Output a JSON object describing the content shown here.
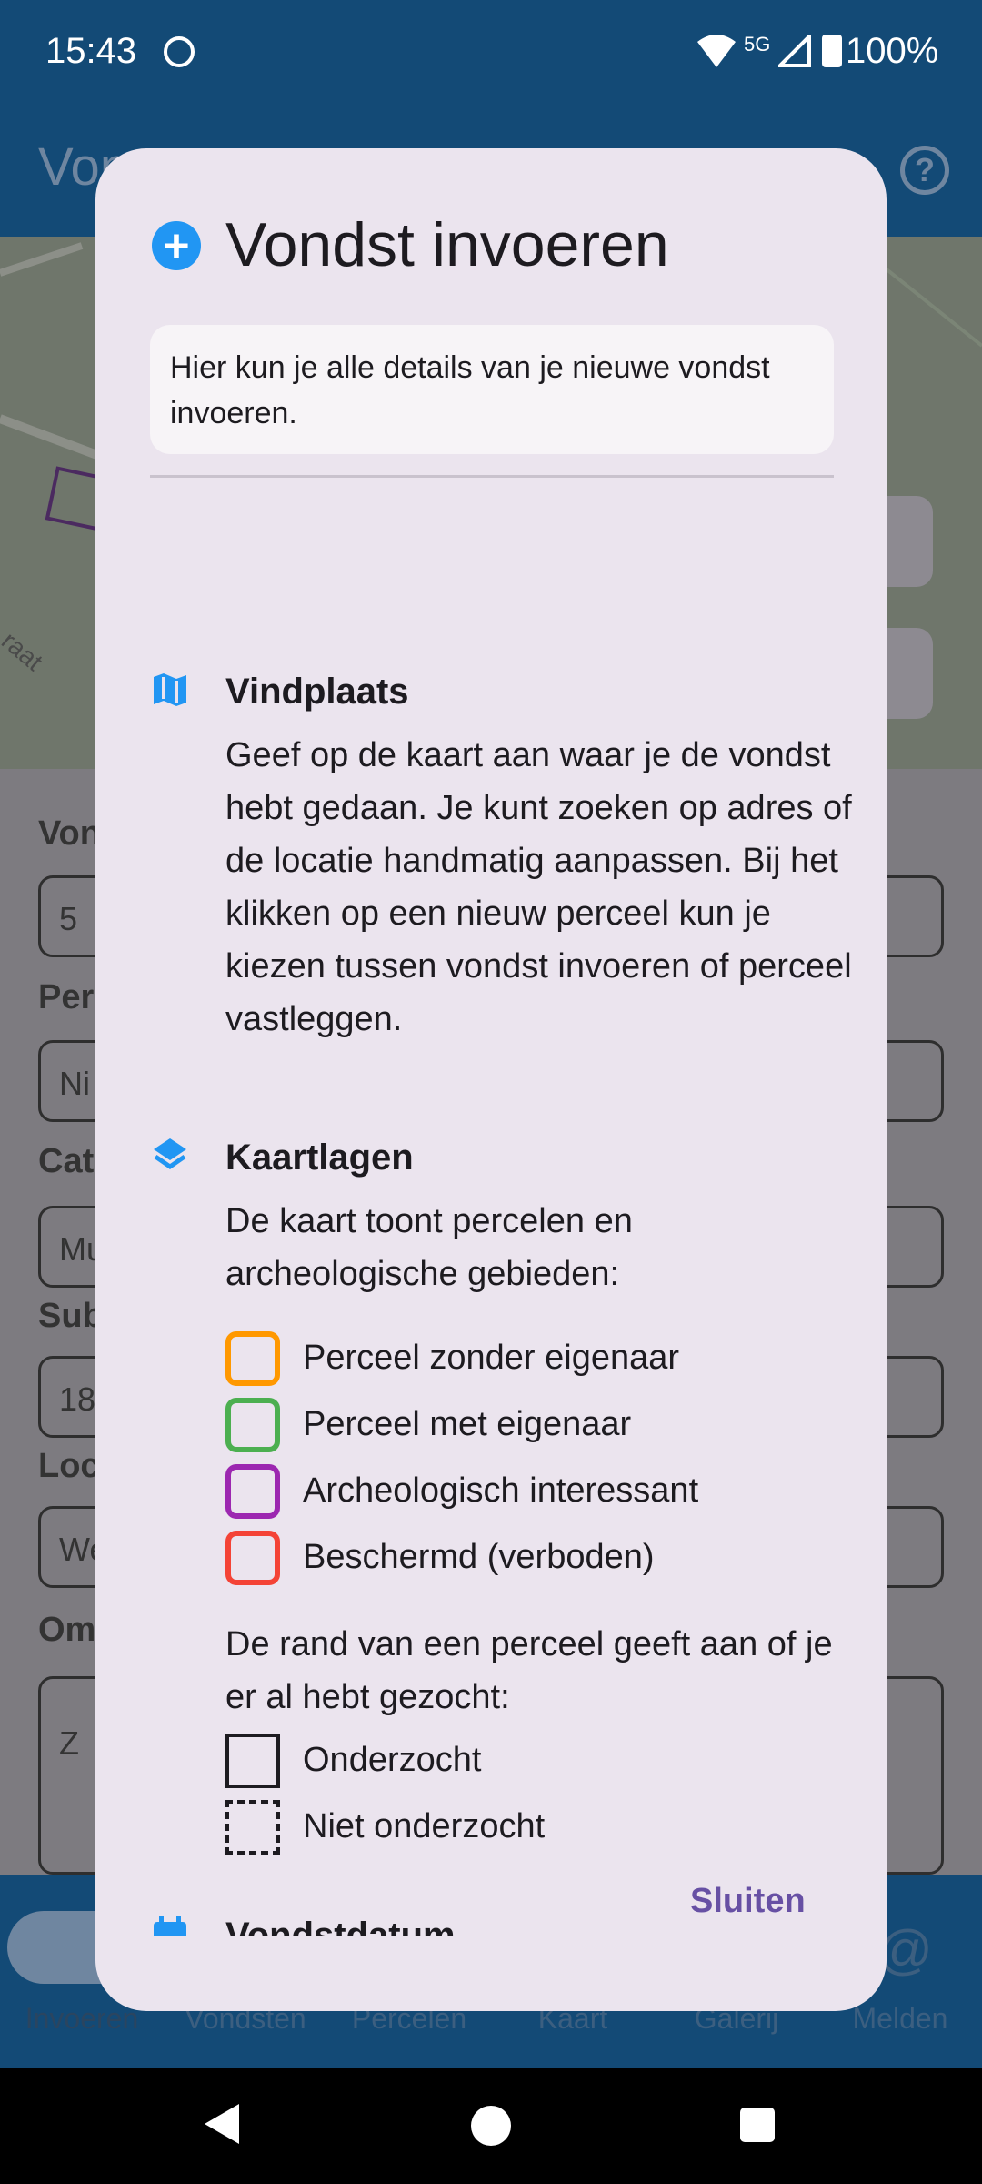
{
  "status_bar": {
    "time": "15:43",
    "network": "5G",
    "battery": "100%"
  },
  "app_bar": {
    "title": "Von",
    "help_symbol": "?"
  },
  "map": {
    "street_label": "raat"
  },
  "form": {
    "labels": [
      "Von",
      "Per",
      "Cat",
      "Sub",
      "Loc",
      "Om"
    ],
    "values": [
      "5",
      "Ni",
      "Mu",
      "18",
      "We",
      "Z"
    ]
  },
  "bottom_nav": {
    "items": [
      "Invoeren",
      "Vondsten",
      "Percelen",
      "Kaart",
      "Galerij",
      "Melden"
    ]
  },
  "dialog": {
    "title": "Vondst invoeren",
    "intro": "Hier kun je alle details van je nieuwe vondst invoeren.",
    "sections": {
      "vindplaats": {
        "heading": "Vindplaats",
        "text": "Geef op de kaart aan waar je de vondst hebt gedaan. Je kunt zoeken op adres of de locatie handmatig aanpassen. Bij het klikken op een nieuw perceel kun je kiezen tussen vondst invoeren of perceel vastleggen."
      },
      "kaartlagen": {
        "heading": "Kaartlagen",
        "text": "De kaart toont percelen en archeologische gebieden:",
        "legend": [
          {
            "label": "Perceel zonder eigenaar",
            "color": "#ff9800"
          },
          {
            "label": "Perceel met eigenaar",
            "color": "#4caf50"
          },
          {
            "label": "Archeologisch interessant",
            "color": "#9c27b0"
          },
          {
            "label": "Beschermd (verboden)",
            "color": "#f44336"
          }
        ],
        "border_text": "De rand van een perceel geeft aan of je er al hebt gezocht:",
        "border_legend": [
          {
            "label": "Onderzocht",
            "style": "solid"
          },
          {
            "label": "Niet onderzocht",
            "style": "dashed"
          }
        ]
      },
      "next_heading": "Vondstdatum"
    },
    "close_label": "Sluiten"
  }
}
